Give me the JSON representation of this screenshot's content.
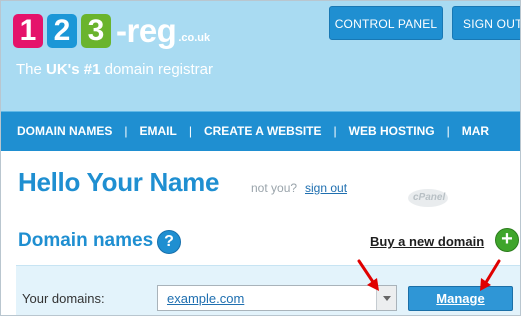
{
  "header": {
    "logo": {
      "digit1": "1",
      "digit2": "2",
      "digit3": "3",
      "name": "-reg",
      "tld": ".co.uk"
    },
    "tagline_pre": "The ",
    "tagline_bold": "UK's #1",
    "tagline_post": " domain registrar",
    "control_panel_label": "CONTROL PANEL",
    "sign_out_label": "SIGN OUT"
  },
  "nav": {
    "items": [
      "DOMAIN NAMES",
      "EMAIL",
      "CREATE A WEBSITE",
      "WEB HOSTING",
      "MAR"
    ],
    "separator": "|"
  },
  "main": {
    "greeting": "Hello Your Name",
    "not_you": "not you?",
    "sign_out_link": "sign out",
    "cpanel_logo_text": "cPanel",
    "domains_heading": "Domain names",
    "help_icon_glyph": "?",
    "buy_link": "Buy a new domain",
    "plus_icon_glyph": "+",
    "your_domains_label": "Your domains:",
    "domain_select_value": "example.com",
    "manage_button": "Manage"
  },
  "colors": {
    "header_bg": "#a9dbf2",
    "brand_blue": "#1f8fd1",
    "logo_pink": "#e5136b",
    "logo_blue": "#1b97d7",
    "logo_green": "#6ab42d",
    "arrow_red": "#e00000"
  }
}
